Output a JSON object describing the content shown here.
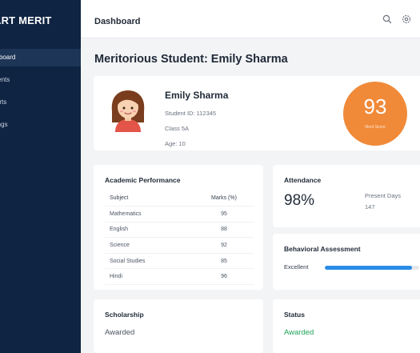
{
  "sidebar": {
    "brand": "ART MERIT",
    "items": [
      {
        "label": "ashboard",
        "active": true
      },
      {
        "label": "tudents",
        "active": false
      },
      {
        "label": "eports",
        "active": false
      },
      {
        "label": "ettings",
        "active": false
      }
    ]
  },
  "header": {
    "title": "Dashboard",
    "icons": [
      "search-icon",
      "settings-icon"
    ]
  },
  "page": {
    "title": "Meritorious Student: Emily Sharma"
  },
  "student": {
    "name": "Emily Sharma",
    "student_id": "Student ID: 112345",
    "class": "Class 5A",
    "age": "Age: 10",
    "score": "93",
    "score_label": "Merit Score"
  },
  "academic": {
    "title": "Academic Performance",
    "columns": [
      "Subject",
      "Marks (%)"
    ],
    "rows": [
      {
        "subject": "Mathematics",
        "marks": "95"
      },
      {
        "subject": "English",
        "marks": "88"
      },
      {
        "subject": "Science",
        "marks": "92"
      },
      {
        "subject": "Social Studies",
        "marks": "85"
      },
      {
        "subject": "Hindi",
        "marks": "96"
      }
    ]
  },
  "attendance": {
    "title": "Attendance",
    "value": "98%",
    "present_label": "Present Days",
    "present_days": "147"
  },
  "behavior": {
    "title": "Behavioral Assessment",
    "label": "Excellent",
    "level": 0.92,
    "bar_color": "#2b8ce6"
  },
  "scholarship": {
    "title": "Scholarship",
    "value": "Awarded"
  },
  "status": {
    "title": "Status",
    "value": "Awarded",
    "value_color": "#22a35a"
  },
  "colors": {
    "sidebar_bg": "#0f2442",
    "accent_orange": "#f08a39"
  }
}
